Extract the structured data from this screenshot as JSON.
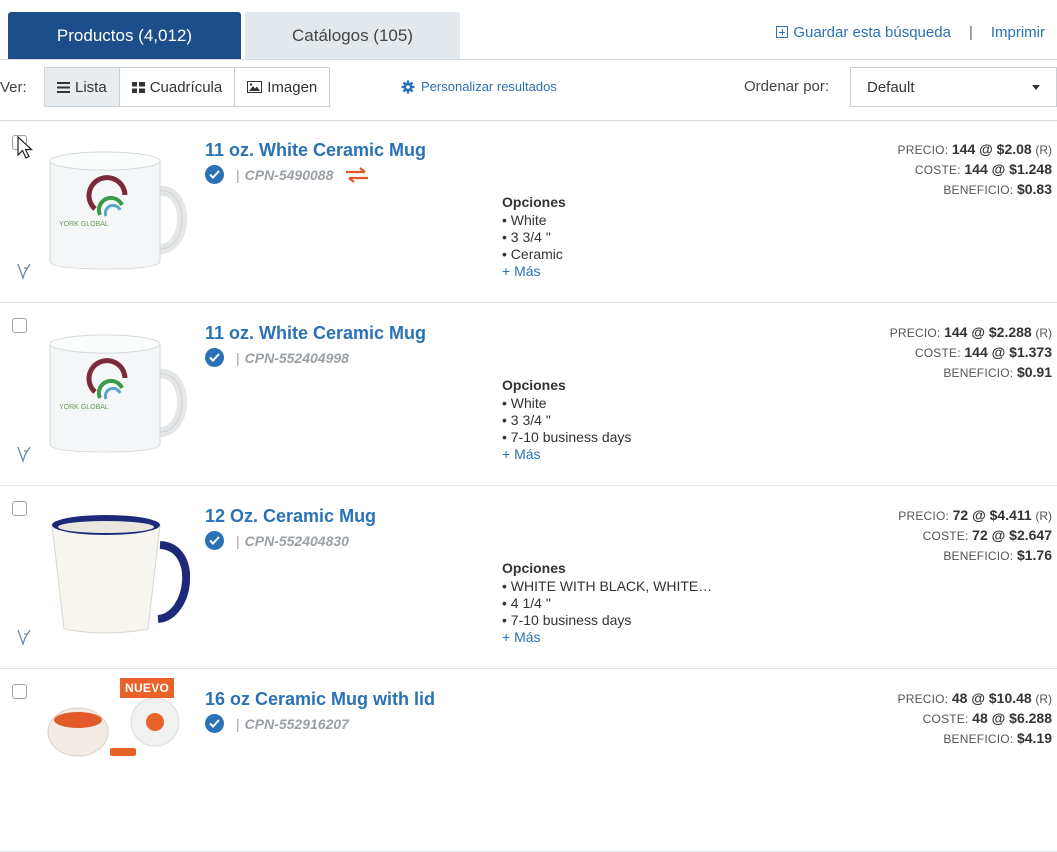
{
  "tabs": [
    {
      "label": "Productos (4,012)",
      "active": true
    },
    {
      "label": "Catálogos (105)",
      "active": false
    }
  ],
  "top_links": {
    "save_search": "Guardar esta búsqueda",
    "separator": "|",
    "print": "Imprimir"
  },
  "toolbar": {
    "view_label": "Ver:",
    "views": [
      {
        "label": "Lista",
        "icon": "list-icon",
        "active": true
      },
      {
        "label": "Cuadrícula",
        "icon": "grid-icon",
        "active": false
      },
      {
        "label": "Imagen",
        "icon": "image-icon",
        "active": false
      }
    ],
    "customize_label": "Personalizar resultados",
    "sort_label": "Ordenar por:",
    "sort_value": "Default"
  },
  "labels": {
    "options": "Opciones",
    "more": "+ Más",
    "price": "PRECIO:",
    "cost": "COSTE:",
    "profit": "BENEFICIO:",
    "new_badge": "NUEVO"
  },
  "products": [
    {
      "title": "11 oz. White Ceramic Mug",
      "sku": "CPN-5490088",
      "options": [
        "White",
        "3 3/4 \"",
        "Ceramic"
      ],
      "price": "144 @ $2.08",
      "price_suffix": "(R)",
      "cost": "144 @ $1.248",
      "profit": "$0.83",
      "thumb_text": "YORK GLOBAL",
      "is_new": false,
      "has_swap": true
    },
    {
      "title": "11 oz. White Ceramic Mug",
      "sku": "CPN-552404998",
      "options": [
        "White",
        "3 3/4 \"",
        "7-10 business days"
      ],
      "price": "144 @ $2.288",
      "price_suffix": "(R)",
      "cost": "144 @ $1.373",
      "profit": "$0.91",
      "thumb_text": "YORK GLOBAL",
      "is_new": false,
      "has_swap": false
    },
    {
      "title": "12 Oz. Ceramic Mug",
      "sku": "CPN-552404830",
      "options": [
        "WHITE WITH BLACK, WHITE…",
        "4 1/4 \"",
        "7-10 business days"
      ],
      "price": "72 @ $4.411",
      "price_suffix": "(R)",
      "cost": "72 @ $2.647",
      "profit": "$1.76",
      "is_new": false,
      "has_swap": false
    },
    {
      "title": "16 oz Ceramic Mug with lid",
      "sku": "CPN-552916207",
      "options": [],
      "price": "48 @ $10.48",
      "price_suffix": "(R)",
      "cost": "48 @ $6.288",
      "profit": "$4.19",
      "is_new": true,
      "has_swap": false
    }
  ],
  "colors": {
    "brand_blue": "#1c4f8a",
    "link_blue": "#2a72b5",
    "badge_orange": "#e8622a"
  }
}
